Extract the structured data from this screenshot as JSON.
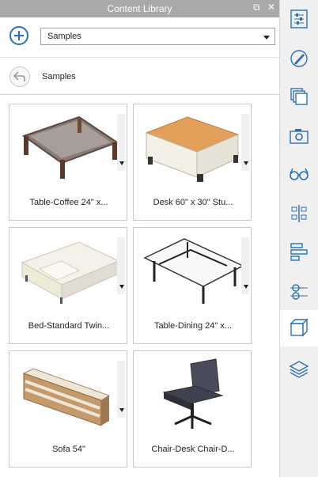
{
  "window": {
    "title": "Content Library",
    "controls": [
      "restore-icon",
      "close-icon"
    ]
  },
  "toolbar": {
    "add_icon": "plus-circle-icon",
    "library_select": "Samples"
  },
  "nav": {
    "back_icon": "back-arrow-icon",
    "breadcrumb": "Samples"
  },
  "items": [
    {
      "label": "Table-Coffee 24\" x...",
      "icon": "coffee-table-thumbnail"
    },
    {
      "label": "Desk 60\" x 30\" Stu...",
      "icon": "desk-thumbnail"
    },
    {
      "label": "Bed-Standard Twin...",
      "icon": "bed-thumbnail"
    },
    {
      "label": "Table-Dining 24\" x...",
      "icon": "dining-table-thumbnail"
    },
    {
      "label": "Sofa 54\"",
      "icon": "sofa-thumbnail"
    },
    {
      "label": "Chair-Desk Chair-D...",
      "icon": "desk-chair-thumbnail"
    }
  ],
  "right_toolbar": [
    {
      "icon": "properties-sliders-icon",
      "active": false
    },
    {
      "icon": "brush-style-icon",
      "active": false
    },
    {
      "icon": "layers-stack-icon",
      "active": false
    },
    {
      "icon": "camera-icon",
      "active": false
    },
    {
      "icon": "glasses-icon",
      "active": false
    },
    {
      "icon": "hierarchy-tree-icon",
      "active": false
    },
    {
      "icon": "align-bars-icon",
      "active": false
    },
    {
      "icon": "axis-crosshair-icon",
      "active": false
    },
    {
      "icon": "content-library-cube-icon",
      "active": true
    },
    {
      "icon": "materials-layers-icon",
      "active": false
    }
  ]
}
